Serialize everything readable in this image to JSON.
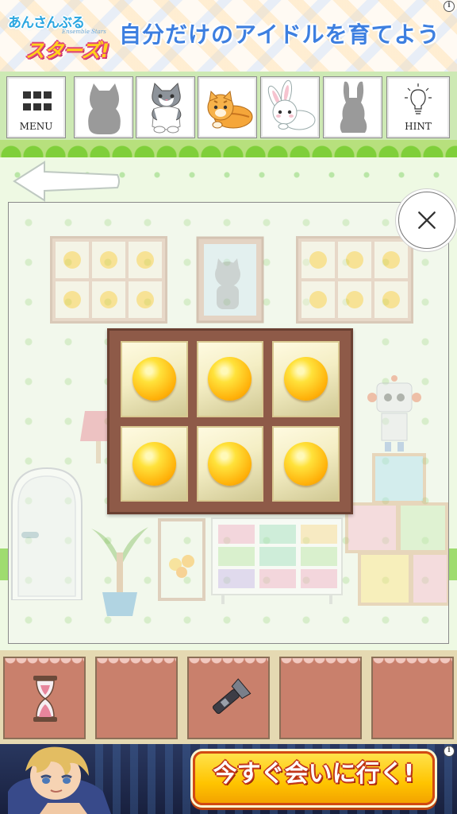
{
  "ad_top": {
    "logo_top": "あんさんぶる",
    "logo_sub": "Ensemble Stars",
    "logo_main": "スターズ!",
    "tagline": "自分だけのアイドルを育てよう",
    "info_mark": "i"
  },
  "toolbar": {
    "menu_label": "MENU",
    "hint_label": "HINT",
    "collection": [
      {
        "name": "gray cat",
        "found": false
      },
      {
        "name": "gray tabby cat",
        "found": true
      },
      {
        "name": "orange tabby cat",
        "found": true
      },
      {
        "name": "white rabbit",
        "found": true
      },
      {
        "name": "rabbit",
        "found": false
      }
    ]
  },
  "puzzle": {
    "rows": 2,
    "cols": 3,
    "balls": [
      "yellow",
      "yellow",
      "yellow",
      "yellow",
      "yellow",
      "yellow"
    ]
  },
  "inventory": [
    "hourglass-icon",
    "",
    "flashlight-icon",
    "",
    ""
  ],
  "ad_bottom": {
    "cta": "今すぐ会いに行く!",
    "info_mark": "i"
  },
  "colors": {
    "ball": "#ffc520",
    "shelf_frame": "#8e5a48",
    "item_slot": "#c9806c",
    "header_green": "#cde9b4",
    "cta": "#ffc400"
  }
}
